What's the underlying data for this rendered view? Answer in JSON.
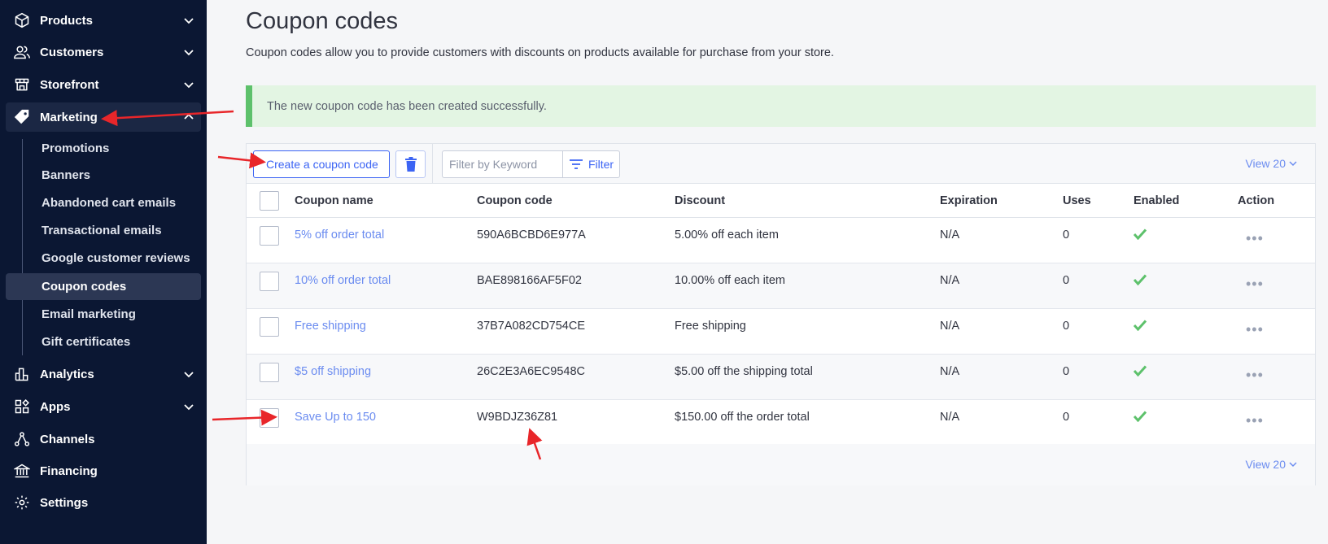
{
  "sidebar": {
    "items": [
      {
        "label": "Products",
        "icon": "box-icon"
      },
      {
        "label": "Customers",
        "icon": "users-icon"
      },
      {
        "label": "Storefront",
        "icon": "store-icon"
      },
      {
        "label": "Marketing",
        "icon": "tag-icon"
      },
      {
        "label": "Analytics",
        "icon": "bar-chart-icon"
      },
      {
        "label": "Apps",
        "icon": "apps-icon"
      },
      {
        "label": "Channels",
        "icon": "channels-icon"
      },
      {
        "label": "Financing",
        "icon": "bank-icon"
      },
      {
        "label": "Settings",
        "icon": "gear-icon"
      }
    ],
    "marketing_sub": [
      "Promotions",
      "Banners",
      "Abandoned cart emails",
      "Transactional emails",
      "Google customer reviews",
      "Coupon codes",
      "Email marketing",
      "Gift certificates"
    ]
  },
  "page": {
    "title": "Coupon codes",
    "description": "Coupon codes allow you to provide customers with discounts on products available for purchase from your store."
  },
  "alert": {
    "message": "The new coupon code has been created successfully."
  },
  "toolbar": {
    "create_label": "Create a coupon code",
    "filter_placeholder": "Filter by Keyword",
    "filter_label": "Filter",
    "view_label": "View 20"
  },
  "table": {
    "columns": [
      "Coupon name",
      "Coupon code",
      "Discount",
      "Expiration",
      "Uses",
      "Enabled",
      "Action"
    ],
    "rows": [
      {
        "name": "5% off order total",
        "code": "590A6BCBD6E977A",
        "discount": "5.00% off each item",
        "expiration": "N/A",
        "uses": "0"
      },
      {
        "name": "10% off order total",
        "code": "BAE898166AF5F02",
        "discount": "10.00% off each item",
        "expiration": "N/A",
        "uses": "0"
      },
      {
        "name": "Free shipping",
        "code": "37B7A082CD754CE",
        "discount": "Free shipping",
        "expiration": "N/A",
        "uses": "0"
      },
      {
        "name": "$5 off shipping",
        "code": "26C2E3A6EC9548C",
        "discount": "$5.00 off the shipping total",
        "expiration": "N/A",
        "uses": "0"
      },
      {
        "name": "Save Up to 150",
        "code": "W9BDJZ36Z81",
        "discount": "$150.00 off the order total",
        "expiration": "N/A",
        "uses": "0"
      }
    ]
  },
  "footer": {
    "view_label": "View 20"
  },
  "colors": {
    "sidebar_bg": "#0b1733",
    "accent": "#3c64f4",
    "link": "#6b8cf0",
    "success": "#5dc16b",
    "annotation": "#e8262a"
  }
}
